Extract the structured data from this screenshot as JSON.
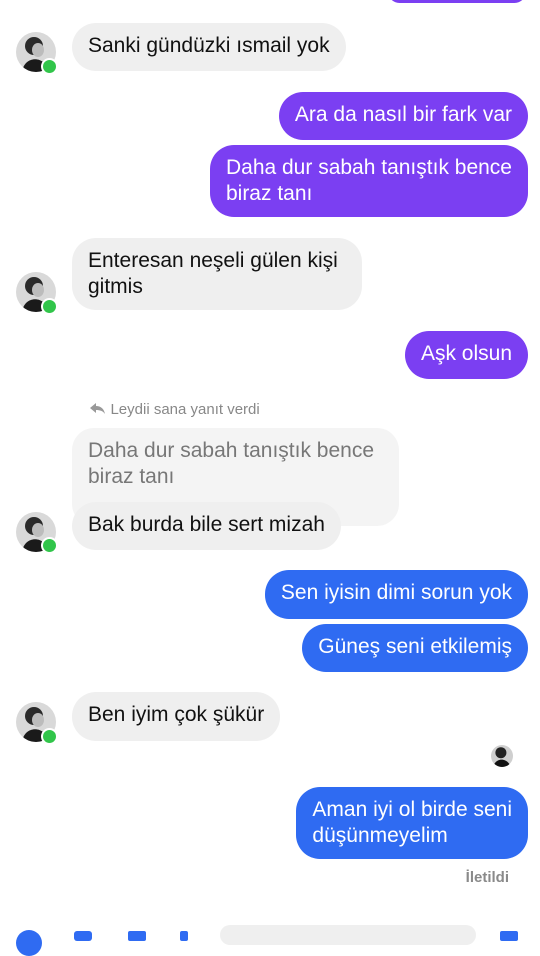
{
  "messages": [
    {
      "id": "m1",
      "side": "in",
      "text": "Sanki gündüzki ısmail yok"
    },
    {
      "id": "m2",
      "side": "out",
      "text": "Ara da nasıl bir fark var"
    },
    {
      "id": "m3",
      "side": "out",
      "text": "Daha dur sabah tanıştık bence\nbiraz tanı"
    },
    {
      "id": "m4",
      "side": "in",
      "text": "Enteresan neşeli gülen kişi\ngitmis"
    },
    {
      "id": "m5",
      "side": "out",
      "text": "Aşk olsun"
    },
    {
      "id": "m6",
      "side": "in",
      "text": "Bak burda bile sert mizah",
      "reply_note": "Leydii sana yanıt verdi",
      "quoted_text": "Daha dur sabah tanıştık bence\nbiraz tanı"
    },
    {
      "id": "m7",
      "side": "out",
      "text": "Sen iyisin dimi sorun yok"
    },
    {
      "id": "m8",
      "side": "out",
      "text": "Güneş seni etkilemiş"
    },
    {
      "id": "m9",
      "side": "in",
      "text": "Ben iyim çok şükür"
    },
    {
      "id": "m10",
      "side": "out",
      "text": "Aman iyi ol birde seni\ndüşünmeyelim"
    }
  ],
  "status": {
    "delivered_label": "İletildi"
  },
  "colors": {
    "purple": "#7b3ff2",
    "blue": "#2f6bf2",
    "incoming": "#efefef",
    "online": "#31c54a"
  },
  "icons": {
    "reply": "reply-arrow-icon",
    "seen_avatar": "seen-avatar-icon"
  }
}
